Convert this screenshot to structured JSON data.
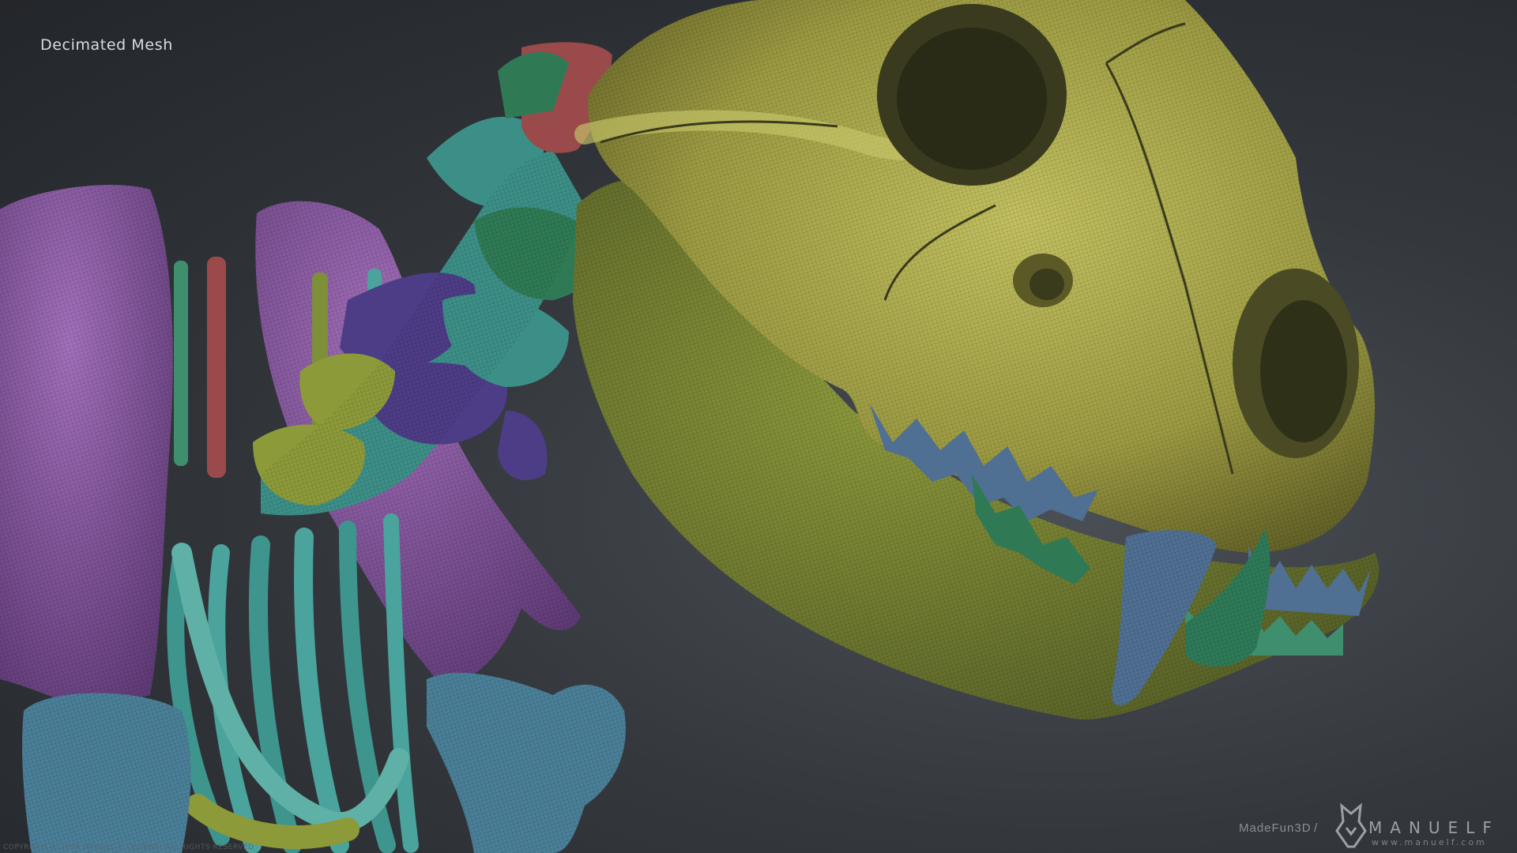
{
  "overlay": {
    "title": "Decimated Mesh"
  },
  "watermark": {
    "studio": "MadeFun3D",
    "separator": "/",
    "brand": "MANUELF",
    "url": "www.manuelf.com"
  },
  "copyright": "COPYRIGHT © 2016 MANUEL F. CEDENO. ALL RIGHTS RESERVED",
  "colors": {
    "skull": "#a7a54a",
    "skull_shade": "#6f6d2c",
    "jaw": "#7f8735",
    "vertebra_teal": "#3c8f87",
    "vertebra_purple": "#4d3c86",
    "vertebra_green": "#2f7a55",
    "vertebra_olive": "#8d9a3a",
    "shoulder_purple": "#8a5aa2",
    "rib_teal": "#4aa39c",
    "rib_red": "#9a4a4a",
    "humerus_blue": "#4a7f98",
    "tooth_blue": "#4f6f93",
    "fang_green": "#2e7a58"
  }
}
